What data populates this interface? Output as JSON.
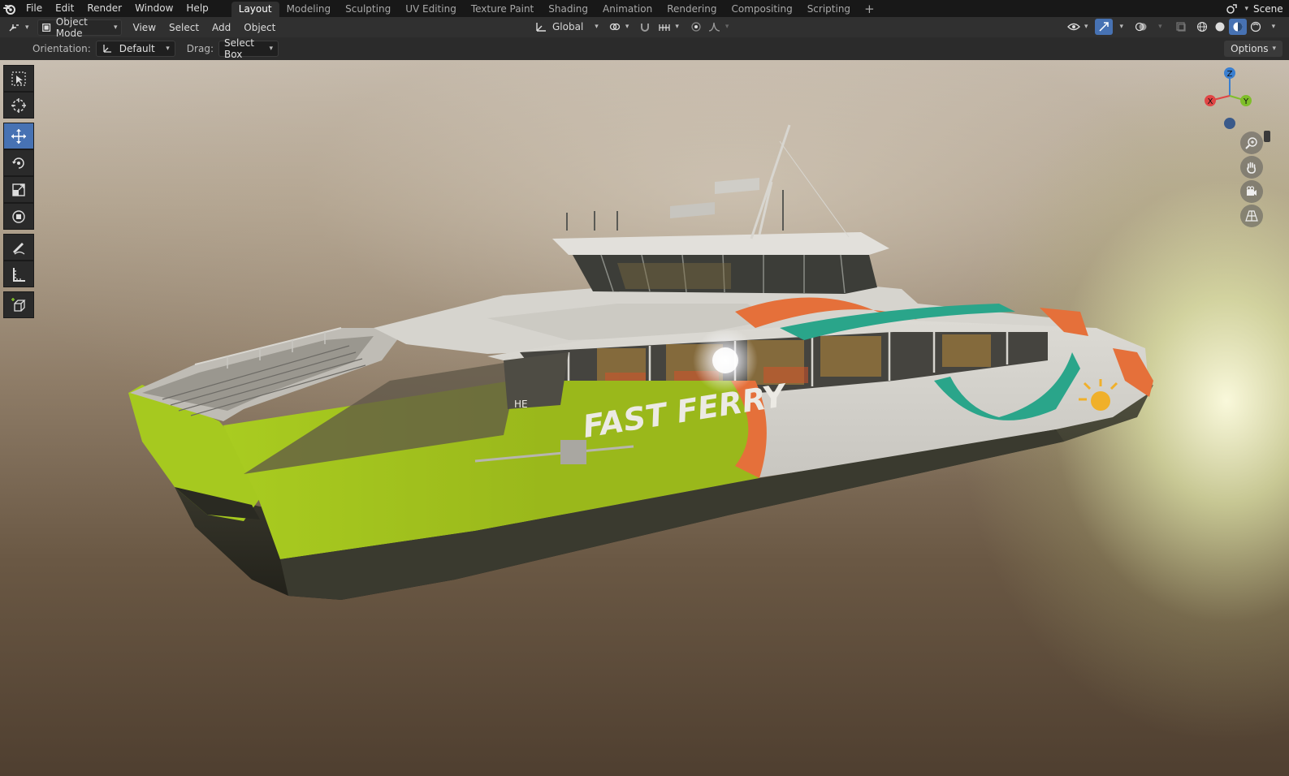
{
  "menu": {
    "items": [
      "File",
      "Edit",
      "Render",
      "Window",
      "Help"
    ]
  },
  "workspaces": {
    "tabs": [
      "Layout",
      "Modeling",
      "Sculpting",
      "UV Editing",
      "Texture Paint",
      "Shading",
      "Animation",
      "Rendering",
      "Compositing",
      "Scripting"
    ],
    "active": "Layout",
    "add_label": "+"
  },
  "topbar": {
    "scene_label": "Scene"
  },
  "header": {
    "mode_label": "Object Mode",
    "menus": [
      "View",
      "Select",
      "Add",
      "Object"
    ],
    "transform_orientation": "Global"
  },
  "tool_settings": {
    "orientation_label": "Orientation:",
    "orientation_value": "Default",
    "drag_label": "Drag:",
    "drag_value": "Select Box",
    "options_label": "Options"
  },
  "toolbar": {
    "tools": [
      "select-box",
      "cursor",
      "move",
      "rotate",
      "scale",
      "transform",
      "annotate",
      "measure",
      "add-cube"
    ],
    "active": "move"
  },
  "gizmo": {
    "x_label": "X",
    "y_label": "Y",
    "z_label": "Z",
    "colors": {
      "x": "#e04545",
      "y": "#7fbe2a",
      "z": "#3a7fd0"
    }
  },
  "scene": {
    "hull_text": "FAST FERRY",
    "hull_small_text": "HE",
    "colors": {
      "hull_green": "#9bc01a",
      "stripe_orange": "#e5703a",
      "stripe_teal": "#2aa58a",
      "cabin_white": "#e8e6e2"
    }
  }
}
